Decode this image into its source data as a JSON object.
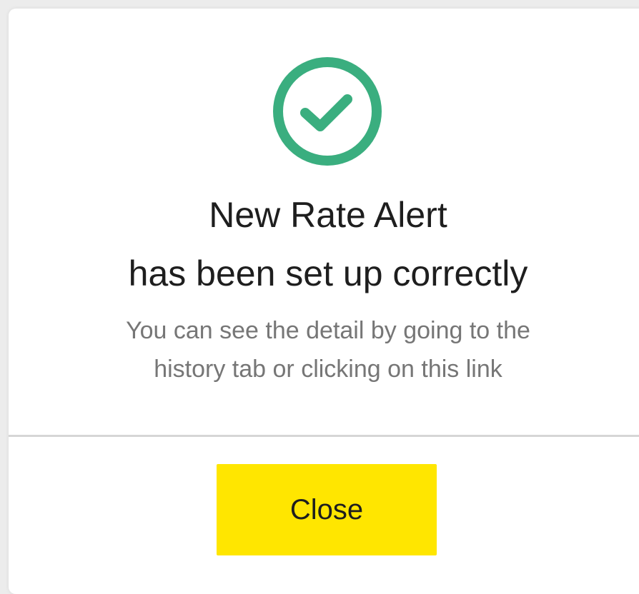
{
  "dialog": {
    "icon": "success-check-circle-icon",
    "title_line1": "New Rate Alert",
    "title_line2": "has been set up correctly",
    "message_line1": "You can see the detail by going to the",
    "message_line2": "history tab or clicking on this link",
    "close_label": "Close"
  },
  "colors": {
    "success": "#3aae7f",
    "primary_button": "#ffe600",
    "title_text": "#1e1e1e",
    "message_text": "#767676",
    "divider": "#d6d6d6"
  }
}
